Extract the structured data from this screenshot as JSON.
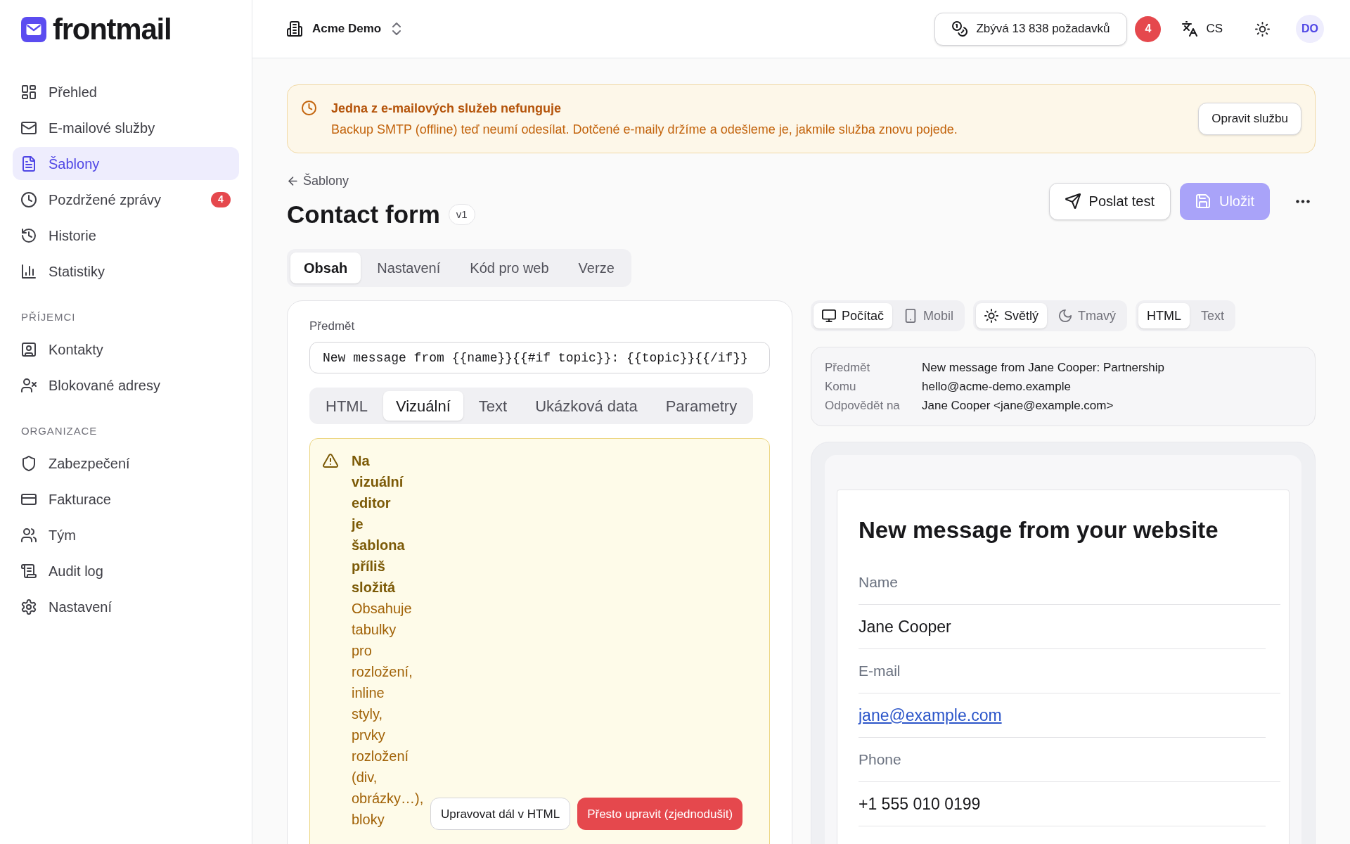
{
  "sidebar": {
    "logo": "frontmail",
    "sections": [
      {
        "items": [
          {
            "label": "Přehled",
            "selected": false
          },
          {
            "label": "E-mailové služby",
            "selected": false
          },
          {
            "label": "Šablony",
            "selected": true
          },
          {
            "label": "Pozdržené zprávy",
            "selected": false,
            "badge": "4"
          },
          {
            "label": "Historie",
            "selected": false
          },
          {
            "label": "Statistiky",
            "selected": false
          }
        ]
      },
      {
        "heading": "PŘÍJEMCI",
        "items": [
          {
            "label": "Kontakty",
            "selected": false
          },
          {
            "label": "Blokované adresy",
            "selected": false
          }
        ]
      },
      {
        "heading": "ORGANIZACE",
        "items": [
          {
            "label": "Zabezpečení",
            "selected": false
          },
          {
            "label": "Fakturace",
            "selected": false
          },
          {
            "label": "Tým",
            "selected": false
          },
          {
            "label": "Audit log",
            "selected": false
          },
          {
            "label": "Nastavení",
            "selected": false
          }
        ]
      }
    ]
  },
  "top_bar": {
    "workspace": "Acme Demo",
    "quota": "Zbývá 13 838 požadavků",
    "notifications": "4",
    "language": "CS",
    "avatar": "DO"
  },
  "alert": {
    "title": "Jedna z e-mailových služeb nefunguje",
    "message": "Backup SMTP (offline) teď neumí odesílat. Dotčené e-maily držíme a odešleme je, jakmile služba znovu pojede.",
    "button": "Opravit službu"
  },
  "header": {
    "breadcrumb": "Šablony",
    "title": "Contact form",
    "version": "v1",
    "actions": [
      {
        "label": "Poslat test",
        "kind": "secondary",
        "disabled": false
      },
      {
        "label": "Uložit",
        "kind": "primary",
        "disabled": true
      }
    ]
  },
  "tabs": [
    {
      "label": "Obsah",
      "selected": true
    },
    {
      "label": "Nastavení",
      "selected": false
    },
    {
      "label": "Kód pro web",
      "selected": false
    },
    {
      "label": "Verze",
      "selected": false
    }
  ],
  "editor": {
    "subject": {
      "label": "Předmět",
      "value": "New message from {{name}}{{#if topic}}: {{topic}}{{/if}}"
    },
    "tabs": [
      {
        "label": "HTML",
        "selected": false
      },
      {
        "label": "Vizuální",
        "selected": true
      },
      {
        "label": "Text",
        "selected": false
      },
      {
        "label": "Ukázková data",
        "selected": false
      },
      {
        "label": "Parametry",
        "selected": false
      }
    ],
    "warning": {
      "title": "Na vizuální editor je šablona příliš složitá",
      "message": "Obsahuje tabulky pro rozložení, inline styly, prvky rozložení (div, obrázky…), bloky",
      "buttons": [
        {
          "label": "Upravovat dál v HTML",
          "kind": "secondary"
        },
        {
          "label": "Přesto upravit (zjednodušit)",
          "kind": "danger"
        }
      ]
    }
  },
  "preview": {
    "toggle_groups": [
      {
        "options": [
          {
            "label": "Počítač",
            "selected": true
          },
          {
            "label": "Mobil",
            "selected": false
          }
        ]
      },
      {
        "options": [
          {
            "label": "Světlý",
            "selected": true
          },
          {
            "label": "Tmavý",
            "selected": false
          }
        ]
      },
      {
        "options": [
          {
            "label": "HTML",
            "selected": true
          },
          {
            "label": "Text",
            "selected": false
          }
        ]
      }
    ],
    "details": [
      {
        "label": "Předmět",
        "value": "New message from Jane Cooper: Partnership"
      },
      {
        "label": "Komu",
        "value": "hello@acme-demo.example"
      },
      {
        "label": "Odpovědět na",
        "value": "Jane Cooper <jane@example.com>"
      }
    ],
    "email": {
      "heading": "New message from your website",
      "fields": [
        {
          "label": "Name",
          "value": "Jane Cooper",
          "kind": "text"
        },
        {
          "label": "E-mail",
          "value": "jane@example.com",
          "kind": "link"
        },
        {
          "label": "Phone",
          "value": "+1 555 010 0199",
          "kind": "text"
        }
      ]
    }
  }
}
